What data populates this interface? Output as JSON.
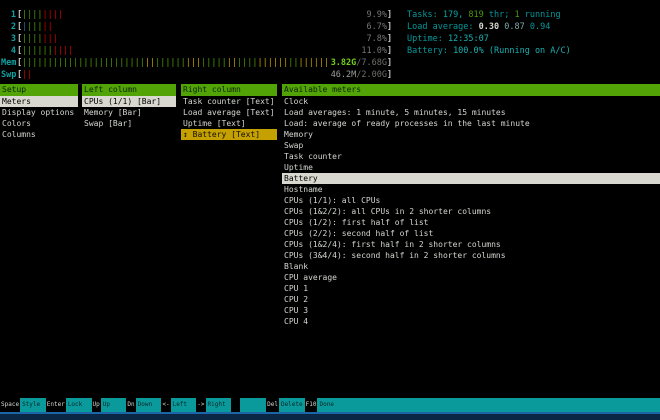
{
  "app": {
    "title": "htop - Setup / Meters"
  },
  "colors": {
    "panel_header_bg": "#52a306",
    "selection_bg": "#d8d8d0",
    "moving_bg": "#c4a000",
    "fnbar_bg": "#0a9a9c",
    "accent_cyan": "#0fa3a3",
    "bar_green": "#4e9a06",
    "bar_red": "#cc0000",
    "bar_blue": "#3465a4",
    "bar_yellow": "#c4a000"
  },
  "header": {
    "meters": [
      {
        "name": "cpu1-meter",
        "label": "1",
        "bar": [
          {
            "c": "#4e9a06",
            "n": 4
          },
          {
            "c": "#cc0000",
            "n": 4
          }
        ],
        "value": [
          {
            "t": "9.9%",
            "c": "#767676"
          }
        ]
      },
      {
        "name": "cpu2-meter",
        "label": "2",
        "bar": [
          {
            "c": "#3465a4",
            "n": 1
          },
          {
            "c": "#4e9a06",
            "n": 3
          },
          {
            "c": "#cc0000",
            "n": 2
          }
        ],
        "value": [
          {
            "t": "6.7%",
            "c": "#767676"
          }
        ]
      },
      {
        "name": "cpu3-meter",
        "label": "3",
        "bar": [
          {
            "c": "#4e9a06",
            "n": 4
          },
          {
            "c": "#cc0000",
            "n": 3
          }
        ],
        "value": [
          {
            "t": "7.8%",
            "c": "#767676"
          }
        ]
      },
      {
        "name": "cpu4-meter",
        "label": "4",
        "bar": [
          {
            "c": "#4e9a06",
            "n": 6
          },
          {
            "c": "#cc0000",
            "n": 4
          }
        ],
        "value": [
          {
            "t": "11.0%",
            "c": "#767676"
          }
        ]
      },
      {
        "name": "memory-meter",
        "label": "Mem",
        "bar": [
          {
            "c": "#4e9a06",
            "n": 24
          },
          {
            "c": "#c4a000",
            "n": 2
          },
          {
            "c": "#4e9a06",
            "n": 6
          },
          {
            "c": "#c4a000",
            "n": 3
          },
          {
            "c": "#4e9a06",
            "n": 5
          },
          {
            "c": "#c4a000",
            "n": 2
          },
          {
            "c": "#4e9a06",
            "n": 4
          },
          {
            "c": "#c4a000",
            "n": 6
          },
          {
            "c": "#4e9a06",
            "n": 2
          },
          {
            "c": "#c4a000",
            "n": 6
          }
        ],
        "value": [
          {
            "t": "3.82G",
            "c": "#73d216",
            "b": true
          },
          {
            "t": "/7.68G",
            "c": "#6e706b"
          }
        ]
      },
      {
        "name": "swap-meter",
        "label": "Swp",
        "bar": [
          {
            "c": "#cc0000",
            "n": 2
          }
        ],
        "value": [
          {
            "t": "46.2M",
            "c": "#9d9f9a"
          },
          {
            "t": "/2.00G",
            "c": "#6e706b"
          }
        ]
      }
    ],
    "info_lines": [
      {
        "name": "tasks-line",
        "spans": [
          {
            "t": "Tasks: ",
            "c": "#06989a"
          },
          {
            "t": "179, ",
            "c": "#0fa3a3"
          },
          {
            "t": "819",
            "c": "#4e9a06"
          },
          {
            "t": " thr; ",
            "c": "#06989a"
          },
          {
            "t": "1",
            "c": "#4e9a06"
          },
          {
            "t": " running",
            "c": "#06989a"
          }
        ]
      },
      {
        "name": "load-average-line",
        "spans": [
          {
            "t": "Load average: ",
            "c": "#06989a"
          },
          {
            "t": "0.30 ",
            "c": "#d3d7cf",
            "b": true
          },
          {
            "t": "0.87 ",
            "c": "#7ea8a8"
          },
          {
            "t": "0.94",
            "c": "#06989a"
          }
        ]
      },
      {
        "name": "uptime-line",
        "spans": [
          {
            "t": "Uptime: ",
            "c": "#06989a"
          },
          {
            "t": "12:35:07",
            "c": "#19b0b0"
          }
        ]
      },
      {
        "name": "battery-line",
        "spans": [
          {
            "t": "Battery: ",
            "c": "#06989a"
          },
          {
            "t": "100.0% (Running on A/C)",
            "c": "#19b0b0"
          }
        ]
      }
    ]
  },
  "setup": {
    "panels": [
      {
        "title": "Setup",
        "items": [
          {
            "label": "Meters",
            "state": "selected"
          },
          {
            "label": "Display options"
          },
          {
            "label": "Colors"
          },
          {
            "label": "Columns"
          }
        ]
      },
      {
        "title": "Left column",
        "items": [
          {
            "label": "CPUs (1/1) [Bar]",
            "state": "selected"
          },
          {
            "label": "Memory [Bar]"
          },
          {
            "label": "Swap [Bar]"
          }
        ]
      },
      {
        "title": "Right column",
        "items": [
          {
            "label": "Task counter [Text]"
          },
          {
            "label": "Load average [Text]"
          },
          {
            "label": "Uptime [Text]"
          },
          {
            "label": "↕ Battery [Text]",
            "state": "moving"
          }
        ]
      },
      {
        "title": "Available meters",
        "items": [
          {
            "label": "Clock"
          },
          {
            "label": "Load averages: 1 minute, 5 minutes, 15 minutes"
          },
          {
            "label": "Load: average of ready processes in the last minute"
          },
          {
            "label": "Memory"
          },
          {
            "label": "Swap"
          },
          {
            "label": "Task counter"
          },
          {
            "label": "Uptime"
          },
          {
            "label": "Battery",
            "state": "selected"
          },
          {
            "label": "Hostname"
          },
          {
            "label": "CPUs (1/1): all CPUs"
          },
          {
            "label": "CPUs (1&2/2): all CPUs in 2 shorter columns"
          },
          {
            "label": "CPUs (1/2): first half of list"
          },
          {
            "label": "CPUs (2/2): second half of list"
          },
          {
            "label": "CPUs (1&2/4): first half in 2 shorter columns"
          },
          {
            "label": "CPUs (3&4/4): second half in 2 shorter columns"
          },
          {
            "label": "Blank"
          },
          {
            "label": "CPU average"
          },
          {
            "label": "CPU 1"
          },
          {
            "label": "CPU 2"
          },
          {
            "label": "CPU 3"
          },
          {
            "label": "CPU 4"
          }
        ]
      }
    ]
  },
  "fnbar": {
    "items": [
      {
        "key": "Space",
        "label": "Style "
      },
      {
        "key": "Enter",
        "label": "Lock  "
      },
      {
        "key": "Up",
        "label": "Up    "
      },
      {
        "key": "Dn",
        "label": "Down  "
      },
      {
        "key": "<-",
        "label": "Left  "
      },
      {
        "key": "->",
        "label": "Right "
      },
      {
        "key": "  ",
        "label": "      "
      },
      {
        "key": "Del",
        "label": "Delete"
      },
      {
        "key": "F10",
        "label": "Done  "
      }
    ]
  }
}
